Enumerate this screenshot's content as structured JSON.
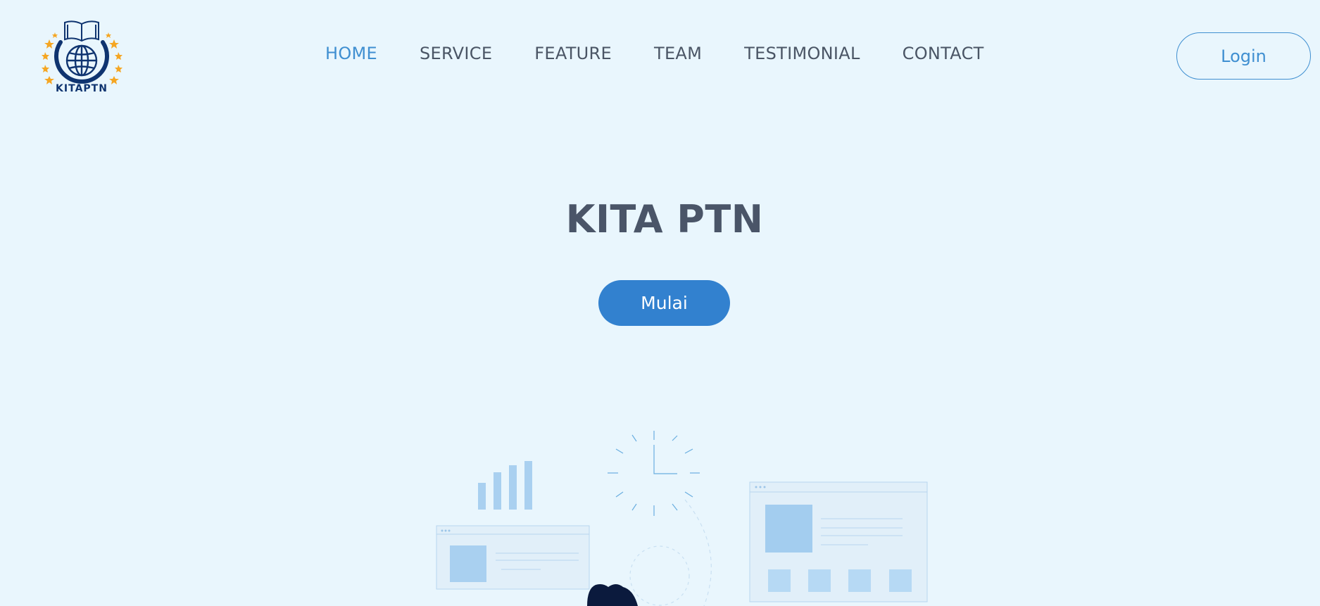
{
  "header": {
    "logo_text": "KITAPTN",
    "nav": [
      {
        "label": "HOME",
        "active": true
      },
      {
        "label": "SERVICE",
        "active": false
      },
      {
        "label": "FEATURE",
        "active": false
      },
      {
        "label": "TEAM",
        "active": false
      },
      {
        "label": "TESTIMONIAL",
        "active": false
      },
      {
        "label": "CONTACT",
        "active": false
      }
    ],
    "login_label": "Login"
  },
  "hero": {
    "title": "KITA PTN",
    "start_label": "Mulai"
  },
  "colors": {
    "background": "#e9f6fd",
    "accent": "#3f8fd1",
    "button": "#3281cf",
    "text": "#4a5568",
    "logo_navy": "#0f3470",
    "logo_star": "#f5a623"
  },
  "icons": [
    "book-icon",
    "globe-icon",
    "star-icon",
    "bar-chart-icon",
    "clock-icon",
    "browser-window-icon"
  ]
}
